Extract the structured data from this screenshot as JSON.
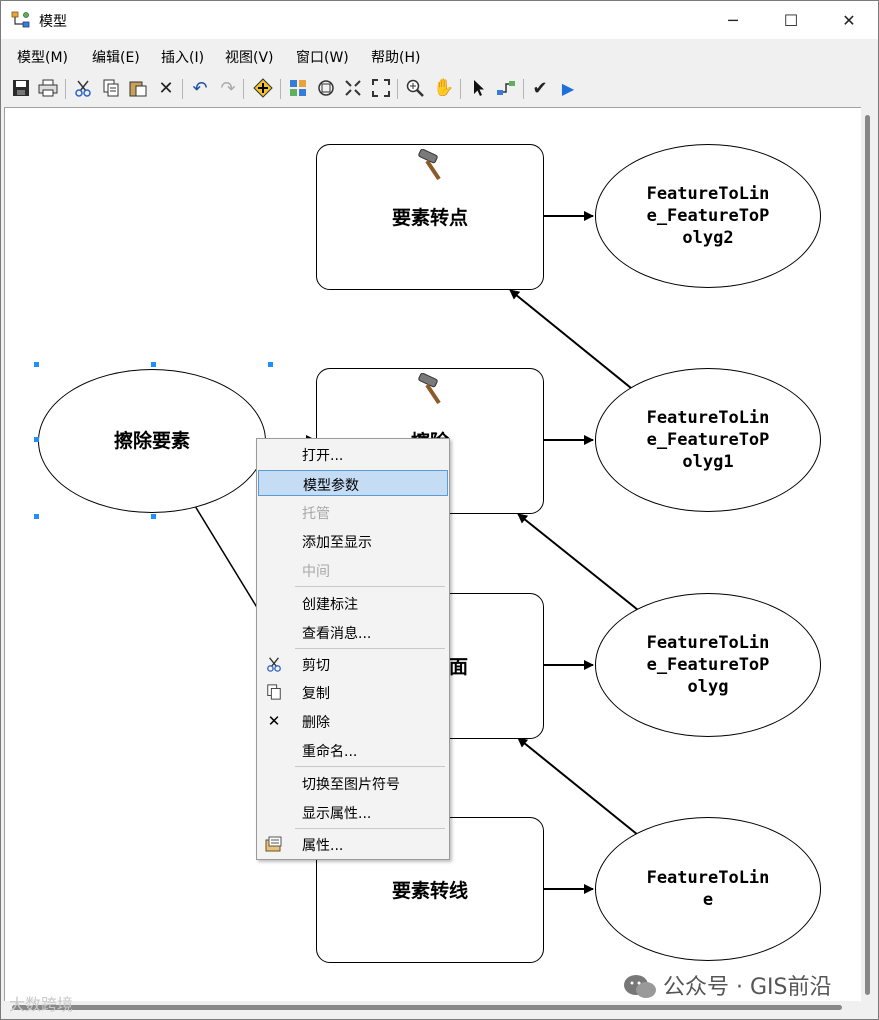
{
  "window": {
    "title": "模型",
    "controls": {
      "minimize": "─",
      "maximize": "☐",
      "close": "✕"
    }
  },
  "menubar": [
    {
      "label": "模型(M)"
    },
    {
      "label": "编辑(E)"
    },
    {
      "label": "插入(I)"
    },
    {
      "label": "视图(V)"
    },
    {
      "label": "窗口(W)"
    },
    {
      "label": "帮助(H)"
    }
  ],
  "toolbar": {
    "icons": [
      "save-icon",
      "print-icon",
      "cut-icon",
      "copy-icon",
      "paste-icon",
      "delete-icon",
      "undo-icon",
      "redo-icon",
      "add-data-icon",
      "auto-layout-icon",
      "full-extent-icon",
      "fit-extent-icon",
      "fixed-zoom-icon",
      "zoom-in-icon",
      "pan-icon",
      "select-icon",
      "connect-icon",
      "validate-icon",
      "run-icon"
    ]
  },
  "model": {
    "processes": [
      {
        "label": "要素转点"
      },
      {
        "label": "擦除"
      },
      {
        "label": "要素转面"
      },
      {
        "label": "要素转线"
      }
    ],
    "outputs": [
      {
        "label": "FeatureToLin\ne_FeatureToP\nolyg2"
      },
      {
        "label": "FeatureToLin\ne_FeatureToP\nolyg1"
      },
      {
        "label": "FeatureToLin\ne_FeatureToP\nolyg"
      },
      {
        "label": "FeatureToLin\ne"
      }
    ],
    "input": {
      "label": "擦除要素"
    }
  },
  "context_menu": {
    "items": [
      {
        "label": "打开...",
        "icon": ""
      },
      {
        "label": "模型参数",
        "icon": "",
        "highlighted": true
      },
      {
        "label": "托管",
        "icon": "",
        "disabled": true
      },
      {
        "label": "添加至显示",
        "icon": ""
      },
      {
        "label": "中间",
        "icon": "",
        "disabled": true
      },
      {
        "label": "创建标注",
        "icon": ""
      },
      {
        "label": "查看消息...",
        "icon": ""
      },
      {
        "label": "剪切",
        "icon": "cut-icon"
      },
      {
        "label": "复制",
        "icon": "copy-icon"
      },
      {
        "label": "删除",
        "icon": "delete-icon"
      },
      {
        "label": "重命名...",
        "icon": ""
      },
      {
        "label": "切换至图片符号",
        "icon": ""
      },
      {
        "label": "显示属性...",
        "icon": ""
      },
      {
        "label": "属性...",
        "icon": "properties-icon"
      }
    ]
  },
  "watermarks": {
    "right": "公众号 · GIS前沿",
    "left": "大数跨境"
  }
}
